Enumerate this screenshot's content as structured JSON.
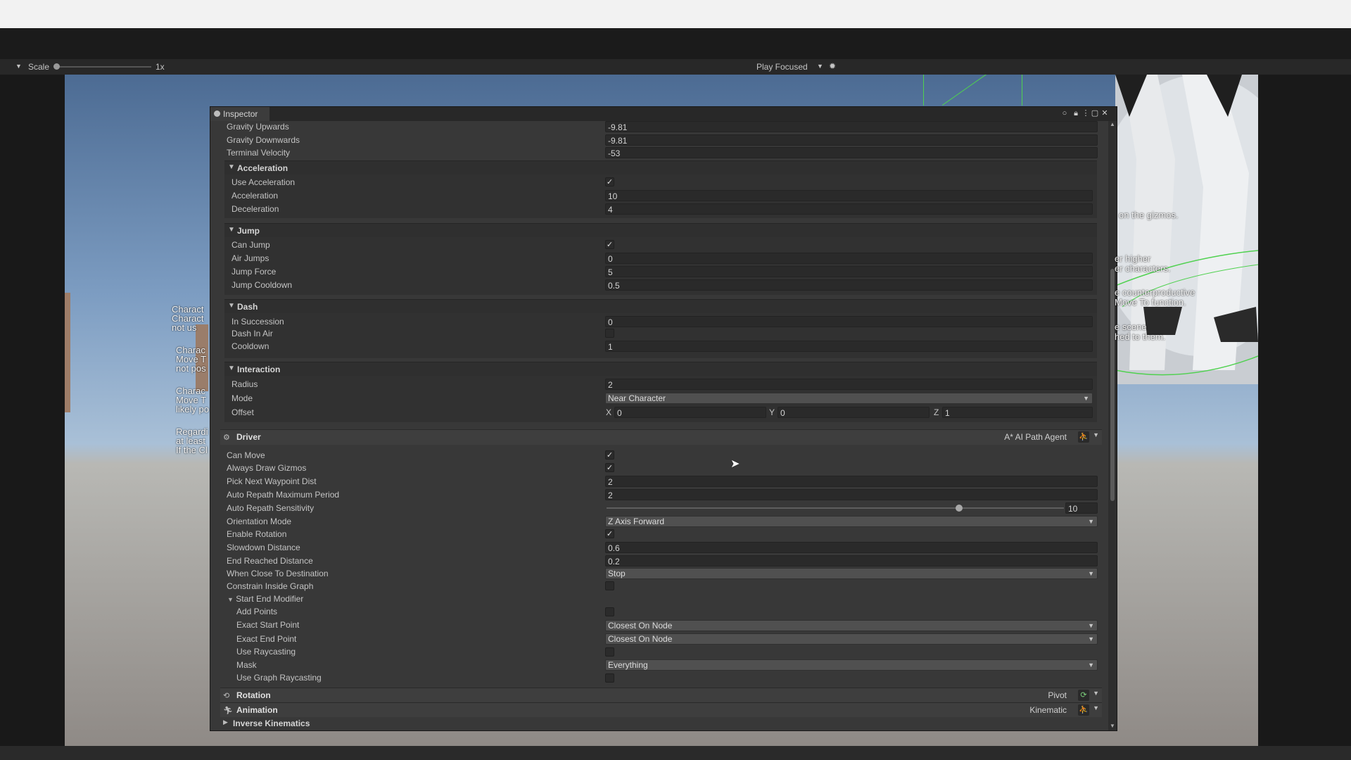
{
  "toolbar": {
    "play_icon": "play-icon",
    "pause_icon": "pause-icon",
    "step_icon": "step-icon"
  },
  "game_bar": {
    "scale_label": "Scale",
    "scale_value": "1x",
    "play_mode": "Play Focused",
    "scale_fraction": 0.0
  },
  "overlay_text": {
    "left_lines": [
      "Charact",
      "Charact",
      "not us",
      "Charac",
      "Move T",
      "not pos",
      "Charac",
      "Move T",
      "likely po",
      "Regardi",
      "at least",
      "If the Cl"
    ],
    "right_lines": [
      "on the gizmos.",
      "er  higher",
      "er characters.",
      "e counterproductive",
      "Move To function.",
      "e scene",
      "hed to them."
    ]
  },
  "inspector": {
    "tab_label": "Inspector",
    "top_rows": [
      {
        "label": "Gravity Upwards",
        "value": "-9.81"
      },
      {
        "label": "Gravity Downwards",
        "value": "-9.81"
      },
      {
        "label": "Terminal Velocity",
        "value": "-53"
      }
    ],
    "acceleration": {
      "title": "Acceleration",
      "use_label": "Use Acceleration",
      "use_checked": "✓",
      "accel_label": "Acceleration",
      "accel_value": "10",
      "decel_label": "Deceleration",
      "decel_value": "4"
    },
    "jump": {
      "title": "Jump",
      "can_label": "Can Jump",
      "can_checked": "✓",
      "air_label": "Air Jumps",
      "air_value": "0",
      "force_label": "Jump Force",
      "force_value": "5",
      "cooldown_label": "Jump Cooldown",
      "cooldown_value": "0.5"
    },
    "dash": {
      "title": "Dash",
      "succession_label": "In Succession",
      "succession_value": "0",
      "air_label": "Dash In Air",
      "cooldown_label": "Cooldown",
      "cooldown_value": "1"
    },
    "interaction": {
      "title": "Interaction",
      "radius_label": "Radius",
      "radius_value": "2",
      "mode_label": "Mode",
      "mode_value": "Near Character",
      "offset_label": "Offset",
      "x_label": "X",
      "x_value": "0",
      "y_label": "Y",
      "y_value": "0",
      "z_label": "Z",
      "z_value": "1"
    },
    "driver": {
      "title": "Driver",
      "agent": "A* AI Path Agent",
      "can_move": "Can Move",
      "can_move_checked": "✓",
      "always_draw": "Always Draw Gizmos",
      "always_draw_checked": "✓",
      "pick_next": "Pick Next Waypoint Dist",
      "pick_next_value": "2",
      "auto_repath_max": "Auto Repath Maximum Period",
      "auto_repath_max_value": "2",
      "auto_repath_sens": "Auto Repath Sensitivity",
      "auto_repath_sens_value": "10",
      "auto_repath_sens_fraction": 0.77,
      "orientation": "Orientation Mode",
      "orientation_value": "Z Axis Forward",
      "enable_rotation": "Enable Rotation",
      "enable_rotation_checked": "✓",
      "slowdown": "Slowdown Distance",
      "slowdown_value": "0.6",
      "end_reached": "End Reached Distance",
      "end_reached_value": "0.2",
      "when_close": "When Close To Destination",
      "when_close_value": "Stop",
      "constrain": "Constrain Inside Graph",
      "start_end": "Start End Modifier",
      "add_points": "Add Points",
      "exact_start": "Exact Start Point",
      "exact_start_value": "Closest On Node",
      "exact_end": "Exact End Point",
      "exact_end_value": "Closest On Node",
      "use_raycasting": "Use Raycasting",
      "mask": "Mask",
      "mask_value": "Everything",
      "use_graph_raycasting": "Use Graph Raycasting"
    },
    "rotation": {
      "title": "Rotation",
      "right": "Pivot"
    },
    "animation": {
      "title": "Animation",
      "right": "Kinematic"
    },
    "ik": {
      "title": "Inverse Kinematics"
    }
  },
  "colors": {
    "panel": "#383838",
    "field": "#2a2a2a",
    "accent_green": "#4fd14f"
  }
}
